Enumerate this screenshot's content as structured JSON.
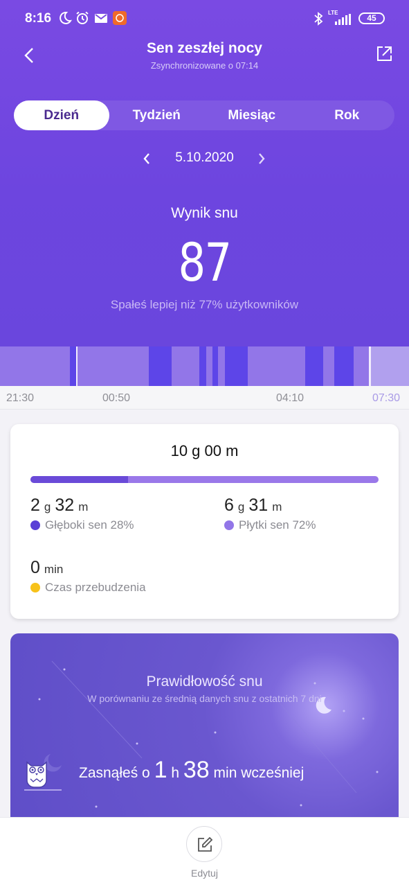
{
  "status_bar": {
    "time": "8:16",
    "icons": [
      "moon-icon",
      "alarm-icon",
      "gmail-icon",
      "mi-app-icon"
    ],
    "right_icons": [
      "bluetooth-icon",
      "lte-signal-icon"
    ],
    "network": "LTE",
    "battery": "45"
  },
  "header": {
    "title": "Sen zeszłej nocy",
    "subtitle": "Zsynchronizowane o 07:14"
  },
  "tabs": [
    {
      "label": "Dzień",
      "active": true
    },
    {
      "label": "Tydzień",
      "active": false
    },
    {
      "label": "Miesiąc",
      "active": false
    },
    {
      "label": "Rok",
      "active": false
    }
  ],
  "date": "5.10.2020",
  "score": {
    "label": "Wynik snu",
    "value": "87",
    "comparison": "Spałeś lepiej niż 77% użytkowników"
  },
  "timeline": {
    "ticks": [
      "21:30",
      "00:50",
      "04:10",
      "07:30"
    ],
    "colors": {
      "light": "#9276e8",
      "deep": "#5d45e8",
      "awake": "#b1a0ee"
    }
  },
  "summary": {
    "total": "10 g 00 m",
    "deep_fraction": 0.28,
    "deep": {
      "h": "2",
      "h_unit": "g",
      "m": "32",
      "m_unit": "m",
      "label": "Głęboki sen 28%",
      "color": "#5a40d6"
    },
    "light": {
      "h": "6",
      "h_unit": "g",
      "m": "31",
      "m_unit": "m",
      "label": "Płytki sen 72%",
      "color": "#9276e8"
    },
    "awake": {
      "value": "0",
      "unit": "min",
      "label": "Czas przebudzenia",
      "color": "#f7c21a"
    }
  },
  "regularity": {
    "title": "Prawidłowość snu",
    "subtitle": "W porównaniu ze średnią danych snu z ostatnich 7 dni",
    "prefix": "Zasnąłeś o",
    "hours": "1",
    "h_unit": "h",
    "minutes": "38",
    "suffix": "min wcześniej"
  },
  "footer": {
    "edit_label": "Edytuj"
  }
}
